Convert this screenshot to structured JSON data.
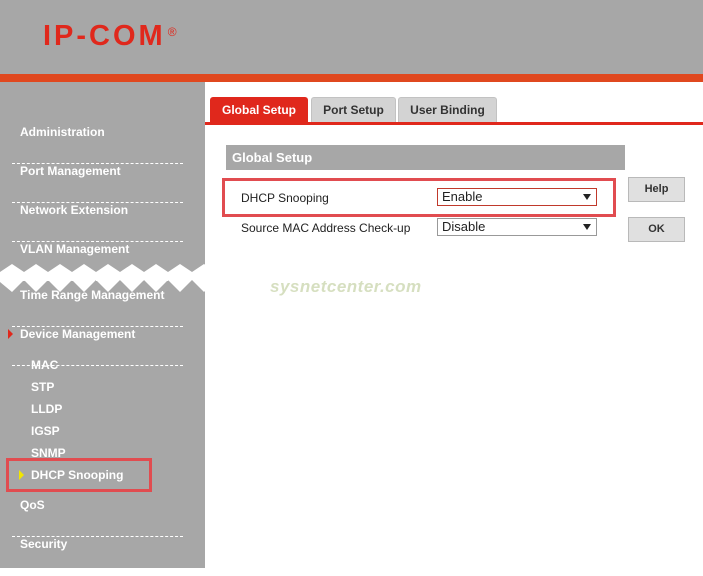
{
  "logo": {
    "text": "IP-COM",
    "mark": "®"
  },
  "sidebar": {
    "groups": [
      {
        "label": "Administration"
      },
      {
        "label": "Port Management"
      },
      {
        "label": "Network Extension"
      },
      {
        "label": "VLAN Management"
      },
      {
        "label": "Time Range Management"
      },
      {
        "label": "Device Management"
      },
      {
        "label": "QoS"
      },
      {
        "label": "Security"
      }
    ],
    "device_items": [
      "MAC",
      "STP",
      "LLDP",
      "IGSP",
      "SNMP",
      "DHCP Snooping"
    ],
    "active_item": "DHCP Snooping"
  },
  "tabs": [
    {
      "label": "Global Setup",
      "active": true
    },
    {
      "label": "Port Setup",
      "active": false
    },
    {
      "label": "User Binding",
      "active": false
    }
  ],
  "panel": {
    "title": "Global Setup",
    "fields": [
      {
        "label": "DHCP Snooping",
        "value": "Enable"
      },
      {
        "label": "Source MAC Address Check-up",
        "value": "Disable"
      }
    ]
  },
  "buttons": {
    "help": "Help",
    "ok": "OK"
  },
  "watermark": "sysnetcenter.com",
  "colors": {
    "accent": "#e0281c",
    "highlight": "#e14c50",
    "panel_gray": "#a7a7a7",
    "arrow_yellow": "#f2e600"
  }
}
